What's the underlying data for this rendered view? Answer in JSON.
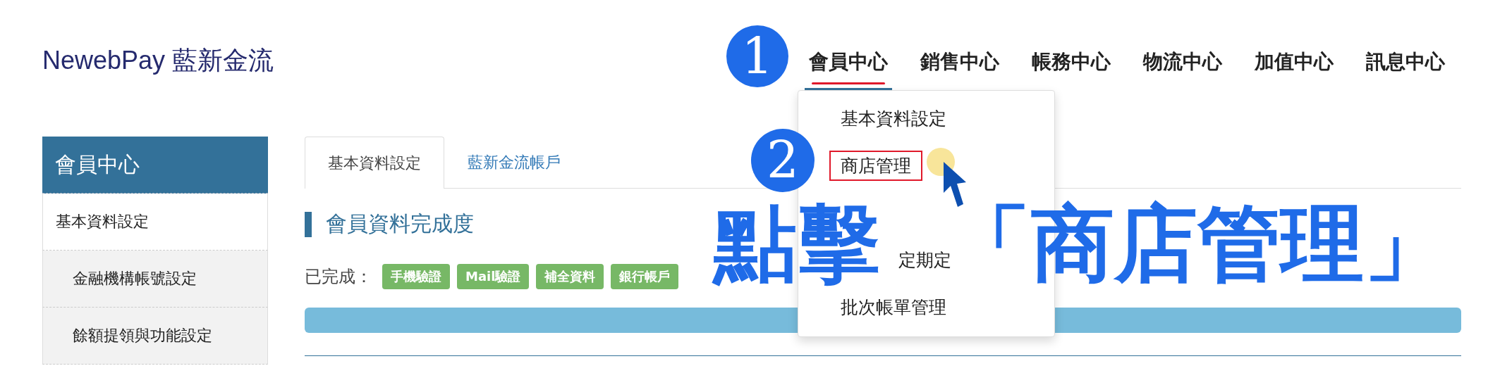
{
  "logo": {
    "brand": "NewebPay",
    "name": "藍新金流"
  },
  "nav": [
    {
      "label": "會員中心",
      "selected": true,
      "marked": true
    },
    {
      "label": "銷售中心",
      "selected": false,
      "marked": false
    },
    {
      "label": "帳務中心",
      "selected": false,
      "marked": false
    },
    {
      "label": "物流中心",
      "selected": false,
      "marked": false
    },
    {
      "label": "加值中心",
      "selected": false,
      "marked": false
    },
    {
      "label": "訊息中心",
      "selected": false,
      "marked": false
    }
  ],
  "dropdown": [
    {
      "kind": "full",
      "label": "基本資料設定",
      "marked": false
    },
    {
      "kind": "full",
      "label": "商店管理",
      "marked": true
    },
    {
      "kind": "hidden"
    },
    {
      "kind": "partial",
      "label": "定期定",
      "marked": false
    },
    {
      "kind": "full",
      "label": "批次帳單管理",
      "marked": false
    }
  ],
  "sidebar": {
    "title": "會員中心",
    "items": [
      {
        "label": "基本資料設定",
        "children": [
          {
            "label": "金融機構帳號設定"
          },
          {
            "label": "餘額提領與功能設定"
          }
        ]
      }
    ]
  },
  "tabs": [
    {
      "label": "基本資料設定",
      "selected": true
    },
    {
      "label": "藍新金流帳戶",
      "selected": false
    }
  ],
  "section_title": "會員資料完成度",
  "completed_label": "已完成：",
  "badges": [
    "手機驗證",
    "Mail驗證",
    "補全資料",
    "銀行帳戶"
  ],
  "progress": {
    "level": 1
  },
  "annotations": {
    "steps": [
      "1",
      "2"
    ],
    "caption": [
      "點擊",
      "「商店管理」"
    ]
  }
}
